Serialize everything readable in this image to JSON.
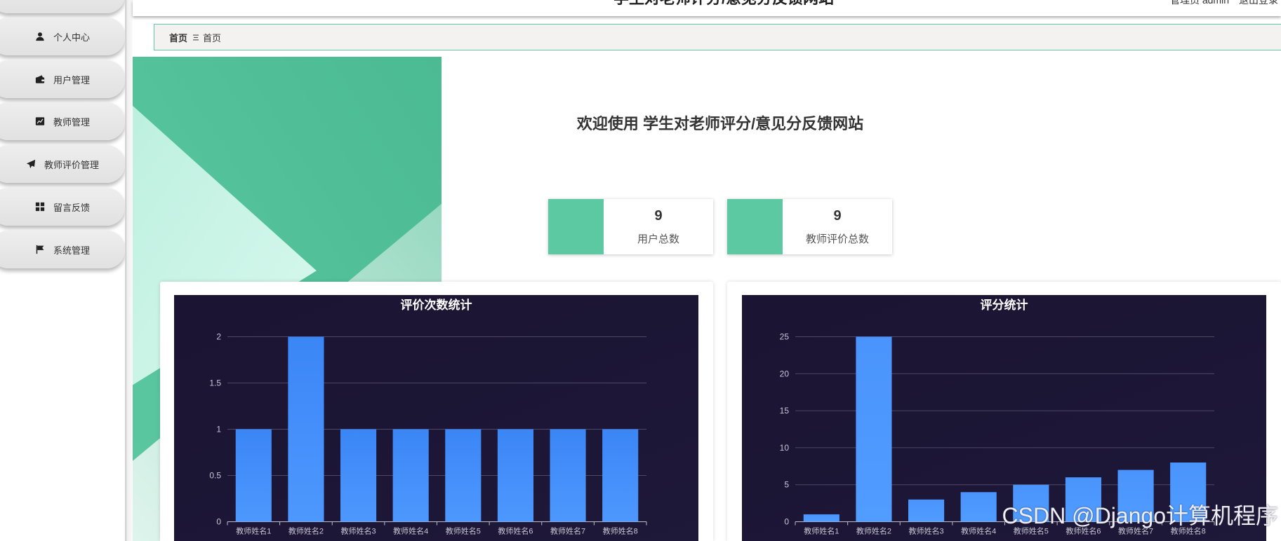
{
  "header": {
    "title": "学生对老师评分/意见分反馈网站",
    "user_label": "管理员 admin",
    "logout_label": "退出登录"
  },
  "sidebar": {
    "items": [
      {
        "label": "个人中心",
        "icon": "user-icon"
      },
      {
        "label": "用户管理",
        "icon": "wallet-icon"
      },
      {
        "label": "教师管理",
        "icon": "area-chart-icon"
      },
      {
        "label": "教师评价管理",
        "icon": "paper-plane-icon"
      },
      {
        "label": "留言反馈",
        "icon": "grid-icon"
      },
      {
        "label": "系统管理",
        "icon": "flag-icon"
      }
    ]
  },
  "breadcrumb": {
    "home": "首页",
    "separator_icon": "menu-icon",
    "current": "首页"
  },
  "welcome": {
    "text": "欢迎使用 学生对老师评分/意见分反馈网站"
  },
  "stats": [
    {
      "value": "9",
      "label": "用户总数"
    },
    {
      "value": "9",
      "label": "教师评价总数"
    }
  ],
  "colors": {
    "accent_green": "#5cc9a3",
    "chart_background": "#1c1535",
    "bar_blue": "#4a94fd"
  },
  "chart_data": [
    {
      "type": "bar",
      "title": "评价次数统计",
      "categories": [
        "教师姓名1",
        "教师姓名2",
        "教师姓名3",
        "教师姓名4",
        "教师姓名5",
        "教师姓名6",
        "教师姓名7",
        "教师姓名8"
      ],
      "values": [
        1,
        2,
        1,
        1,
        1,
        1,
        1,
        1
      ],
      "yticks": [
        0,
        0.5,
        1,
        1.5,
        2
      ],
      "ylim": [
        0,
        2
      ],
      "grid": true,
      "bar_color_top": "#3b86f6",
      "bar_color_bottom": "#4d98fe"
    },
    {
      "type": "bar",
      "title": "评分统计",
      "categories": [
        "教师姓名1",
        "教师姓名2",
        "教师姓名3",
        "教师姓名4",
        "教师姓名5",
        "教师姓名6",
        "教师姓名7",
        "教师姓名8"
      ],
      "values": [
        1,
        25,
        3,
        4,
        5,
        6,
        7,
        8
      ],
      "yticks": [
        0,
        5,
        10,
        15,
        20,
        25
      ],
      "ylim": [
        0,
        25
      ],
      "grid": true,
      "bar_color_top": "#4a94fd",
      "bar_color_bottom": "#509cff"
    }
  ],
  "watermark": "CSDN @Django计算机程序"
}
